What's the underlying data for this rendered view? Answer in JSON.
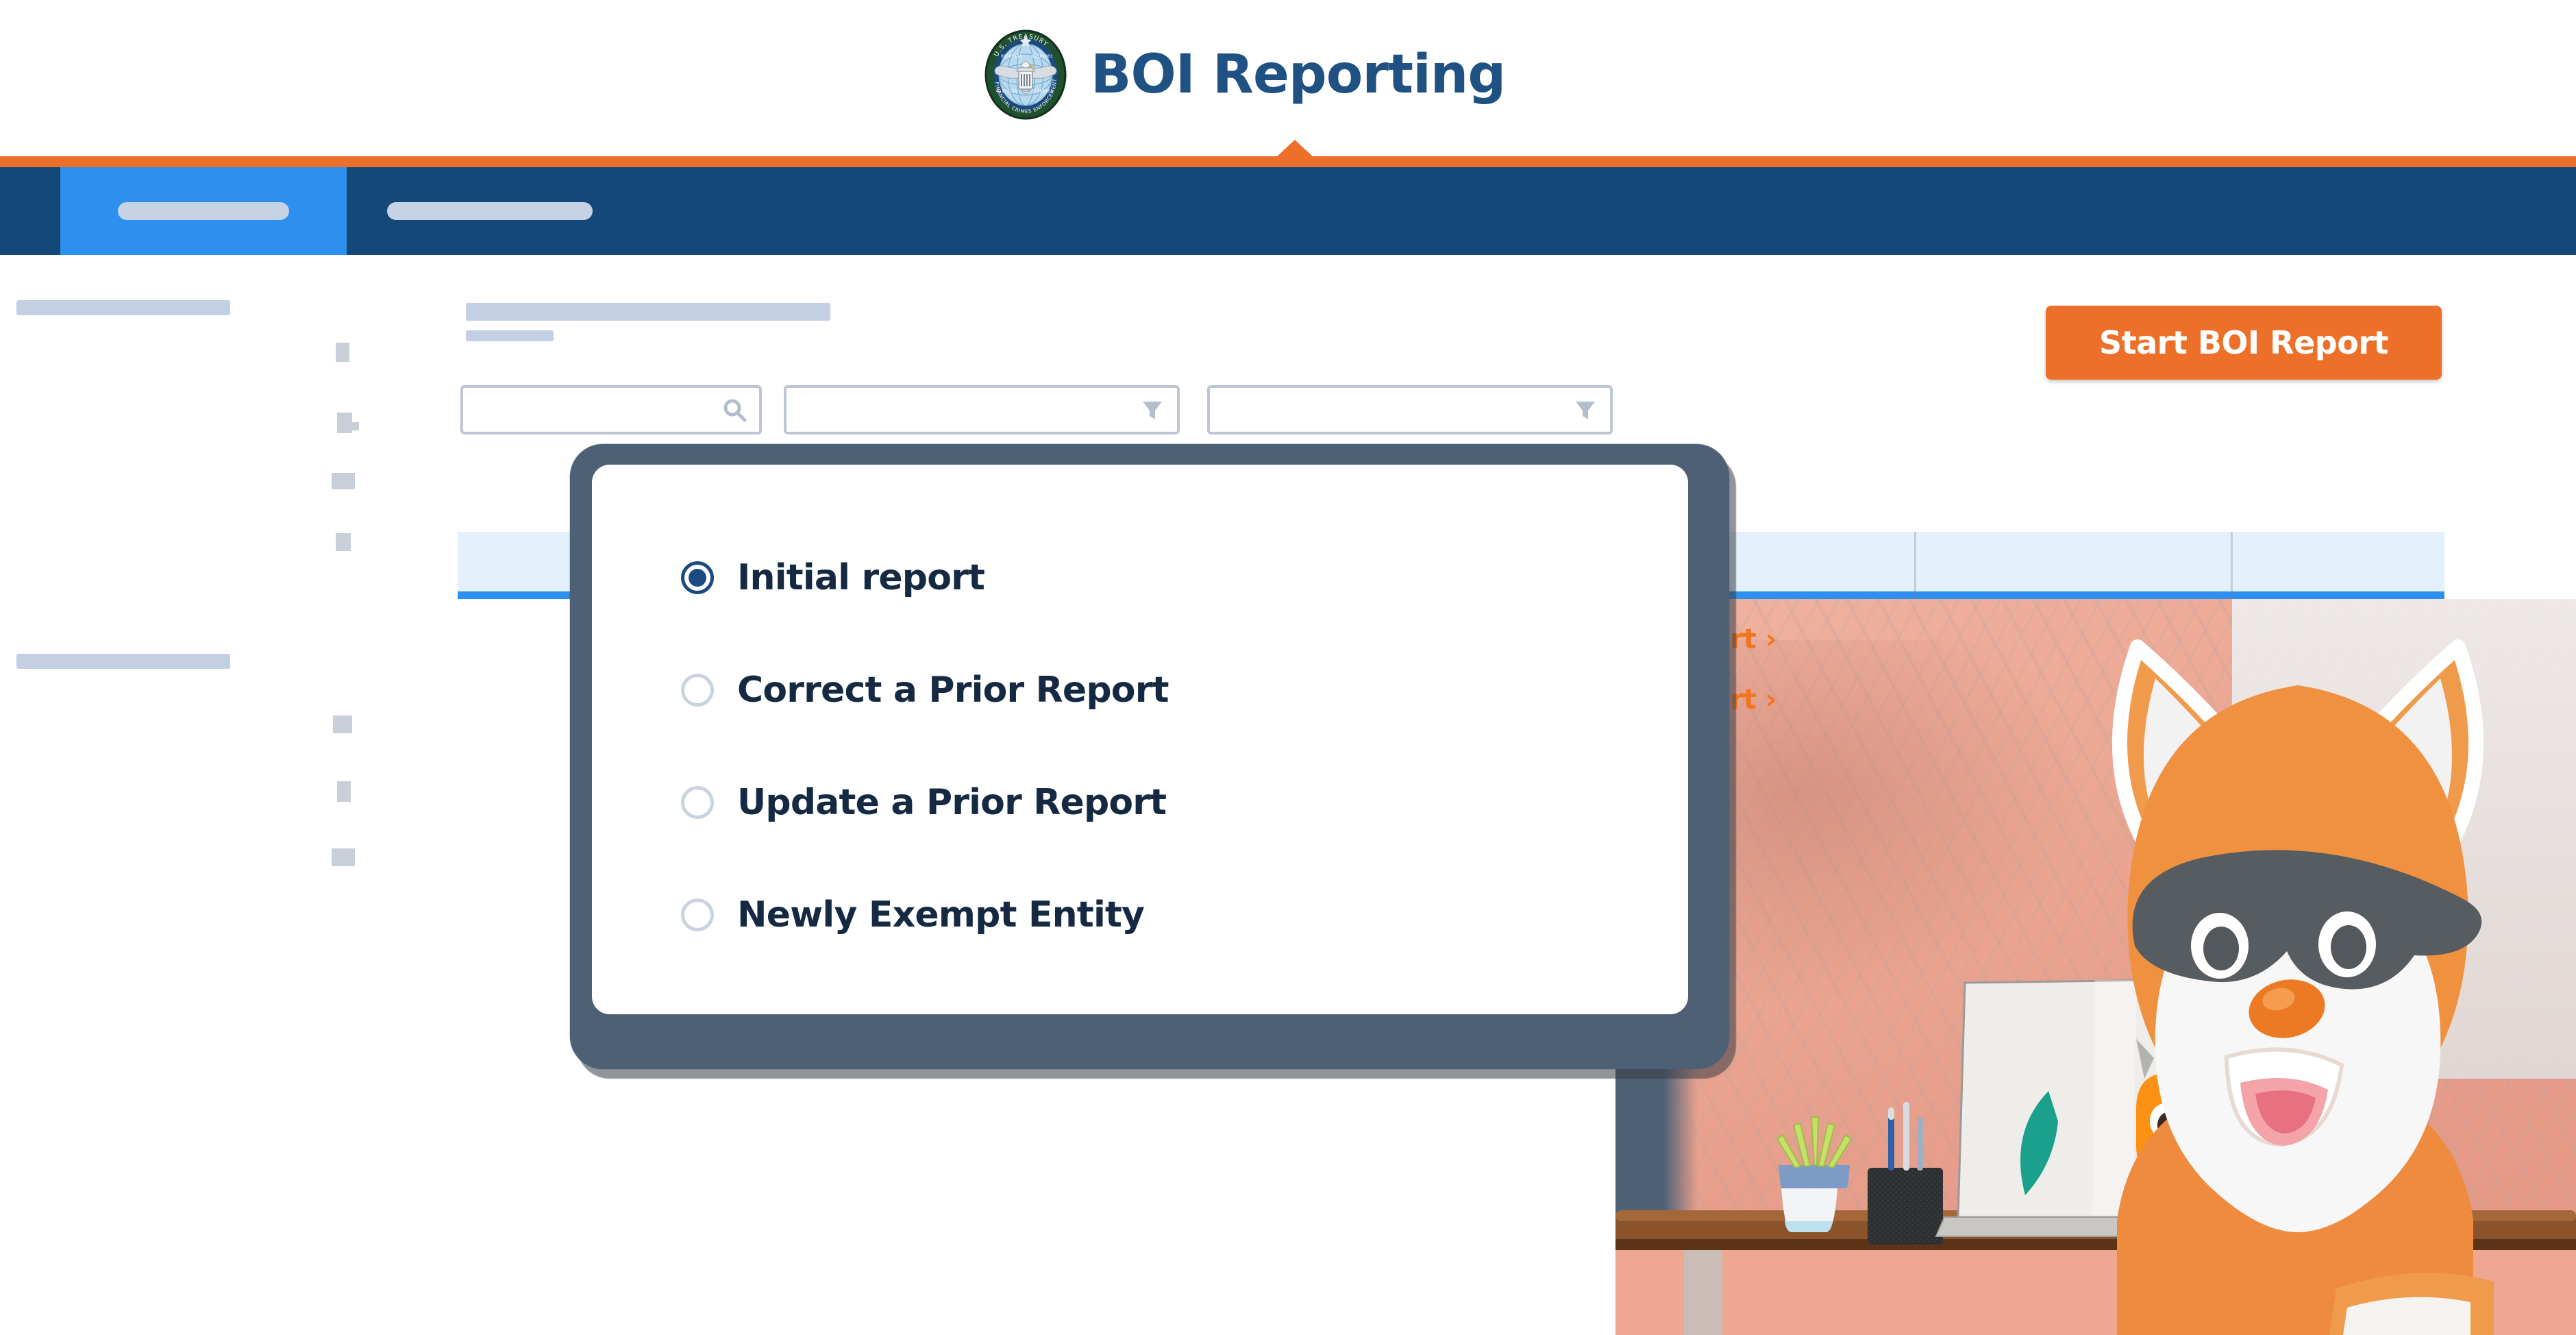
{
  "header": {
    "brand_title": "BOI Reporting",
    "seal_text_top": "U.S. TREASURY",
    "seal_text_bottom": "FINANCIAL CRIMES ENFORCEMENT NETWORK",
    "seal_icon": "fincen-seal-icon",
    "notch_icon": "triangle-up-icon"
  },
  "navbar": {
    "active_tab_label": "",
    "inactive_tab_label": "",
    "tabs": [
      {
        "name": "tab-primary",
        "label": "",
        "active": true
      },
      {
        "name": "tab-secondary",
        "label": "",
        "active": false
      }
    ]
  },
  "toolbar": {
    "start_report_label": "Start BOI Report"
  },
  "filters": [
    {
      "name": "search-input",
      "value": "",
      "placeholder": "",
      "icon": "search-icon"
    },
    {
      "name": "filter-select-1",
      "value": "",
      "placeholder": "",
      "icon": "filter-funnel-icon"
    },
    {
      "name": "filter-select-2",
      "value": "",
      "placeholder": "",
      "icon": "filter-funnel-icon"
    }
  ],
  "table": {
    "row_links": [
      {
        "label": "Start",
        "chevron": "›"
      },
      {
        "label": "Start",
        "chevron": "›"
      }
    ]
  },
  "modal": {
    "title": "",
    "selected_option": "Initial report",
    "options": [
      {
        "label": "Initial report",
        "selected": true
      },
      {
        "label": "Correct a Prior Report",
        "selected": false
      },
      {
        "label": "Update a Prior Report",
        "selected": false
      },
      {
        "label": "Newly Exempt Entity",
        "selected": false
      }
    ]
  },
  "illustration": {
    "mascot": "fox-mascot-with-bandit-mask",
    "laptop_sticker": "owl-eyes-sticker",
    "desk_items": [
      "succulent-plant",
      "pen-holder",
      "laptop",
      "notebook"
    ]
  },
  "colors": {
    "brand_navy": "#134878",
    "accent_orange": "#EC702A",
    "active_blue": "#2E90EE",
    "skeleton": "#C3D0E3",
    "modal_border": "#4D6076",
    "highlight_band": "#E4F0FB",
    "text_dark": "#152A42"
  }
}
